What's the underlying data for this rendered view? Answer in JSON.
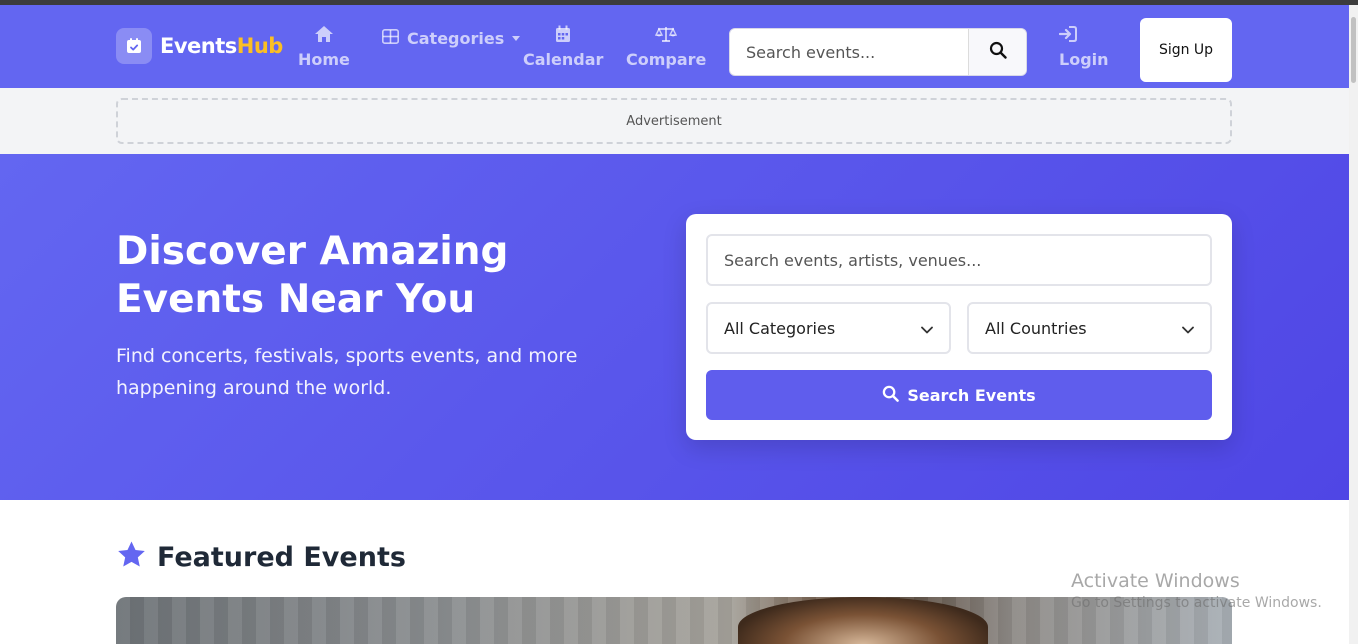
{
  "brand": {
    "name_main": "Events",
    "name_accent": "Hub"
  },
  "nav": {
    "home": "Home",
    "categories": "Categories",
    "calendar": "Calendar",
    "compare": "Compare",
    "search_placeholder": "Search events...",
    "login": "Login",
    "signup": "Sign Up"
  },
  "ad": {
    "label": "Advertisement"
  },
  "hero": {
    "title": "Discover Amazing Events Near You",
    "subtitle": "Find concerts, festivals, sports events, and more happening around the world.",
    "search_placeholder": "Search events, artists, venues...",
    "category_select": "All Categories",
    "country_select": "All Countries",
    "search_button": "Search Events"
  },
  "featured": {
    "title": "Featured Events"
  },
  "watermark": {
    "line1": "Activate Windows",
    "line2": "Go to Settings to activate Windows."
  },
  "colors": {
    "primary": "#6366f1",
    "accent": "#fbbf24",
    "button": "#5f5ded"
  }
}
